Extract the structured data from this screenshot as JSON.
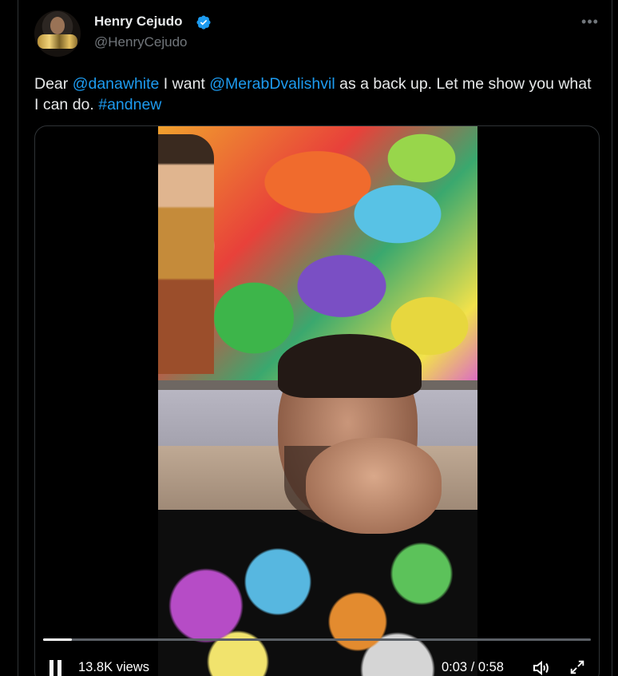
{
  "author": {
    "name": "Henry Cejudo",
    "handle": "@HenryCejudo",
    "verified": true,
    "verified_color": "#1d9bf0",
    "avatar_icon": "avatar-championship-belts"
  },
  "tweet": {
    "segments": [
      {
        "text": "Dear ",
        "type": "text"
      },
      {
        "text": "@danawhite",
        "type": "mention"
      },
      {
        "text": " I want ",
        "type": "text"
      },
      {
        "text": "@MerabDvalishvil",
        "type": "mention"
      },
      {
        "text": " as a back up. Let me show you what I can do. ",
        "type": "text"
      },
      {
        "text": "#andnew",
        "type": "hashtag"
      }
    ]
  },
  "video": {
    "views": "13.8K views",
    "current_time": "0:03",
    "duration": "0:58",
    "time_display": "0:03 / 0:58",
    "progress_fraction": 0.052,
    "state": "playing"
  },
  "colors": {
    "background": "#000000",
    "text": "#e7e9ea",
    "secondary_text": "#71767b",
    "link": "#1d9bf0",
    "border": "#2f3336"
  },
  "icons": {
    "more": "more-horizontal-icon",
    "pause": "pause-icon",
    "volume": "volume-icon",
    "fullscreen": "fullscreen-icon"
  }
}
